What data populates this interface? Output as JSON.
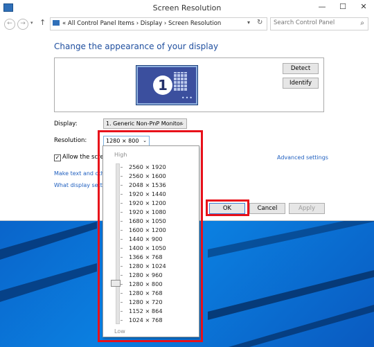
{
  "window": {
    "title": "Screen Resolution"
  },
  "titlebar": {
    "minimize": "—",
    "maximize": "☐",
    "close": "✕"
  },
  "address": {
    "prefix": "«",
    "path": [
      "All Control Panel Items",
      "Display",
      "Screen Resolution"
    ],
    "separator": "›"
  },
  "search": {
    "placeholder": "Search Control Panel"
  },
  "main": {
    "heading": "Change the appearance of your display",
    "monitor_number": "1",
    "detect_label": "Detect",
    "identify_label": "Identify",
    "display_label": "Display:",
    "display_value": "1. Generic Non-PnP Monitor",
    "resolution_label": "Resolution:",
    "resolution_value": "1280 × 800",
    "allow_label": "Allow the scree",
    "advanced_link": "Advanced settings",
    "text_link": "Make text and othe",
    "what_link": "What display setti"
  },
  "buttons": {
    "ok": "OK",
    "cancel": "Cancel",
    "apply": "Apply"
  },
  "resolution_popup": {
    "high_label": "High",
    "low_label": "Low",
    "selected": "1280 × 800",
    "options": [
      "2560 × 1920",
      "2560 × 1600",
      "2048 × 1536",
      "1920 × 1440",
      "1920 × 1200",
      "1920 × 1080",
      "1680 × 1050",
      "1600 × 1200",
      "1440 × 900",
      "1400 × 1050",
      "1366 × 768",
      "1280 × 1024",
      "1280 × 960",
      "1280 × 800",
      "1280 × 768",
      "1280 × 720",
      "1152 × 864",
      "1024 × 768"
    ]
  },
  "colors": {
    "highlight": "#e8101a",
    "link": "#1f5fbf",
    "heading": "#1e4e9e",
    "wallpaper": "#0a63c9"
  }
}
